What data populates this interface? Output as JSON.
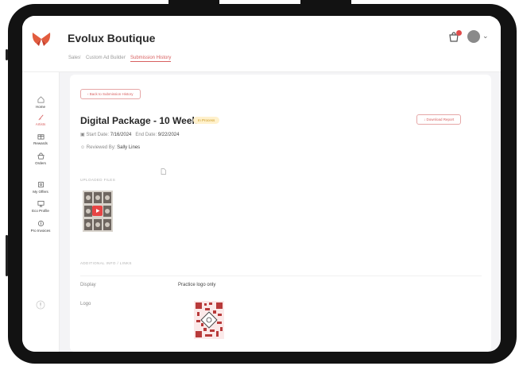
{
  "app": {
    "title": "Evolux Boutique"
  },
  "breadcrumb": [
    "Sales",
    "Custom Ad Builder",
    "Submission History"
  ],
  "sidebar": {
    "items": [
      {
        "label": "Home",
        "icon": "home-icon"
      },
      {
        "label": "Artists",
        "icon": "brush-icon"
      },
      {
        "label": "Rewards",
        "icon": "gift-icon"
      },
      {
        "label": "Orders",
        "icon": "bag-icon"
      },
      {
        "label": "My Offers",
        "icon": "tag-icon"
      },
      {
        "label": "Eco Profile",
        "icon": "monitor-icon"
      },
      {
        "label": "Pro Invoices",
        "icon": "invoice-icon"
      }
    ]
  },
  "main": {
    "back_label": "Back to Submission History",
    "title": "Digital Package - 10 Weeks",
    "status": "In Process",
    "download_label": "Download Report",
    "start_label": "Start Date:",
    "start_date": "7/16/2024",
    "end_label": "End Date:",
    "end_date": "9/22/2024",
    "reviewed_label": "Reviewed By:",
    "reviewed_by": "Sally Lines",
    "uploaded_label": "UPLOADED FILES",
    "additional_label": "ADDITIONAL INFO / LINKS",
    "display_label": "Display",
    "display_value": "Practice logo only",
    "logo_label": "Logo"
  },
  "colors": {
    "accent": "#d86060",
    "status_bg": "#fff1cc",
    "status_fg": "#c9971f",
    "play": "#e64545"
  }
}
